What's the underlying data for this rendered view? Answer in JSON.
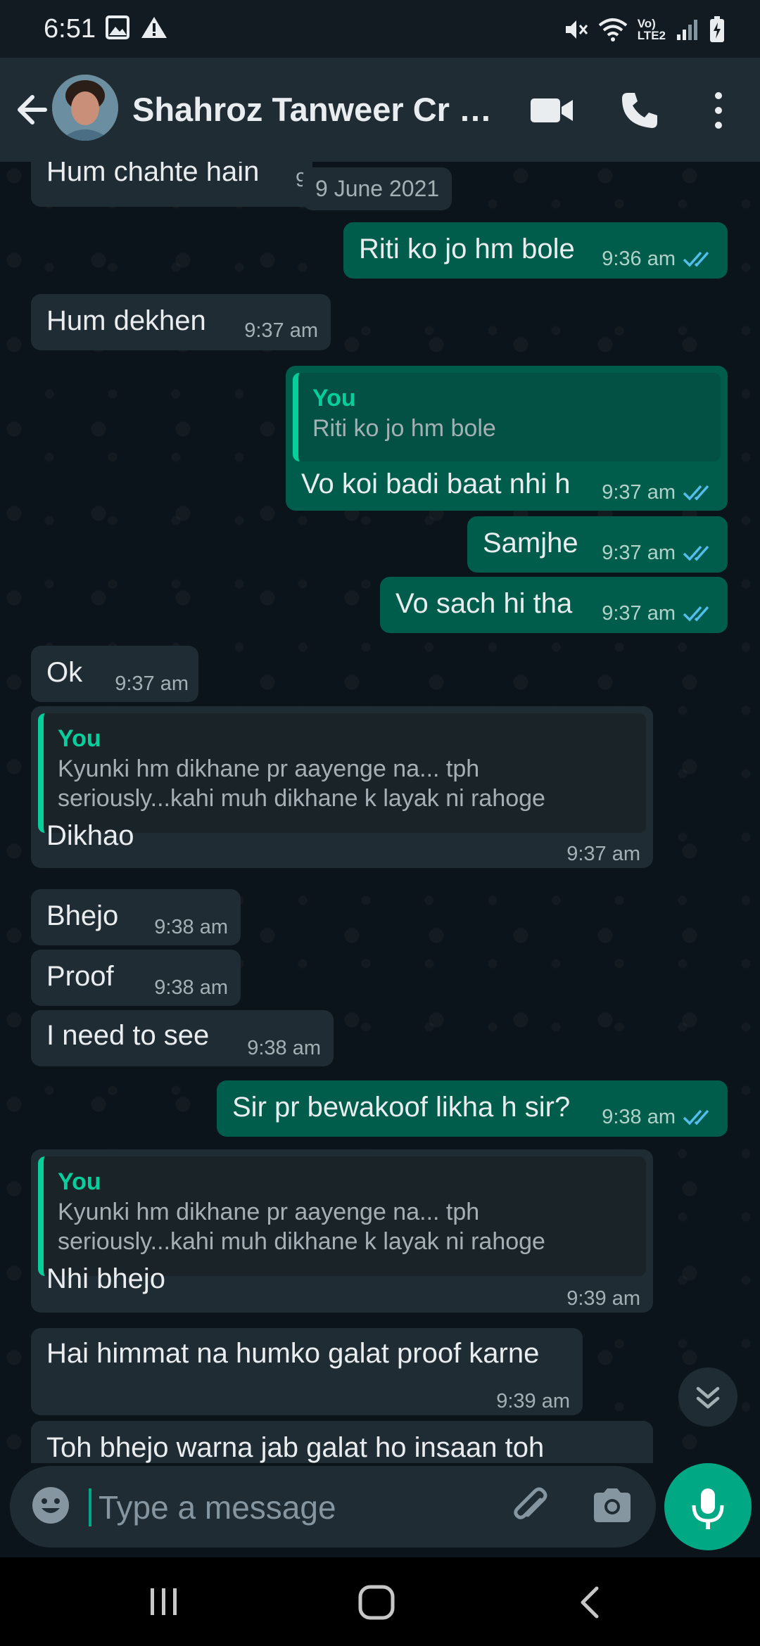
{
  "status_bar": {
    "time": "6:51",
    "network_label_top": "Vo)",
    "network_label_bottom": "LTE2"
  },
  "app_bar": {
    "contact_name": "Shahroz Tanweer Cr Civ..."
  },
  "chat": {
    "date_chip": "9 June 2021",
    "partial_top_message": {
      "text": "Hum chahte hain",
      "time": "9"
    },
    "messages": [
      {
        "dir": "out",
        "text": "Riti ko jo hm bole",
        "time": "9:36 am"
      },
      {
        "dir": "in",
        "text": "Hum dekhen",
        "time": "9:37 am"
      },
      {
        "dir": "out",
        "quote_author": "You",
        "quote_text": "Riti ko jo hm bole",
        "text": "Vo koi badi baat nhi h",
        "time": "9:37 am"
      },
      {
        "dir": "out",
        "text": "Samjhe",
        "time": "9:37 am"
      },
      {
        "dir": "out",
        "text": "Vo sach hi tha",
        "time": "9:37 am"
      },
      {
        "dir": "in",
        "text": "Ok",
        "time": "9:37 am"
      },
      {
        "dir": "in",
        "quote_author": "You",
        "quote_text": "Kyunki hm dikhane pr aayenge na... tph\nseriously...kahi muh dikhane k layak ni rahoge",
        "text": "Dikhao",
        "time": "9:37 am"
      },
      {
        "dir": "in",
        "text": "Bhejo",
        "time": "9:38 am"
      },
      {
        "dir": "in",
        "text": "Proof",
        "time": "9:38 am"
      },
      {
        "dir": "in",
        "text": "I need to see",
        "time": "9:38 am"
      },
      {
        "dir": "out",
        "text": "Sir pr bewakoof likha h sir?",
        "time": "9:38 am"
      },
      {
        "dir": "in",
        "quote_author": "You",
        "quote_text": "Kyunki hm dikhane pr aayenge na... tph\nseriously...kahi muh dikhane k layak ni rahoge",
        "text": "Nhi bhejo",
        "time": "9:39 am"
      },
      {
        "dir": "in",
        "text": "Hai himmat na humko galat proof karne",
        "time": "9:39 am"
      },
      {
        "dir": "in",
        "text": "Toh bhejo warna jab galat ho insaan toh",
        "time": ""
      }
    ]
  },
  "composer": {
    "placeholder": "Type a message"
  },
  "icons": {
    "back": "arrow-left-icon",
    "video": "video-call-icon",
    "call": "phone-icon",
    "more": "more-vertical-icon",
    "emoji": "emoji-icon",
    "attach": "paperclip-icon",
    "camera": "camera-icon",
    "mic": "microphone-icon",
    "scroll_down": "double-chevron-down-icon",
    "read_ticks": "double-check-icon"
  },
  "colors": {
    "accent": "#00a884",
    "outgoing_bubble": "#005c4b",
    "incoming_bubble": "#1f2c34",
    "read_ticks": "#53bdeb"
  }
}
